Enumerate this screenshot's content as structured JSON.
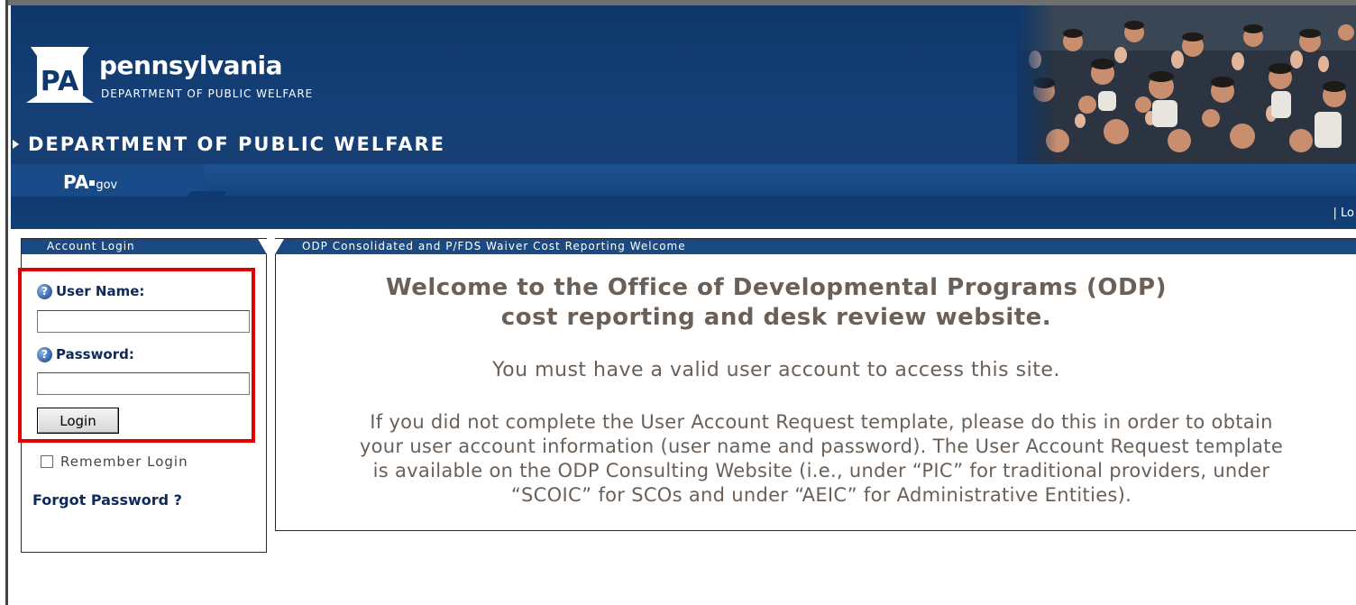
{
  "header": {
    "logo_text": "PA",
    "brand_name": "pennsylvania",
    "brand_subtitle": "DEPARTMENT OF PUBLIC WELFARE",
    "department_title": "DEPARTMENT OF PUBLIC WELFARE",
    "header_color": "#10386c"
  },
  "nav": {
    "portal_prefix": "PA",
    "portal_suffix": "gov",
    "right_link": "| Lo"
  },
  "login": {
    "panel_title": "Account Login",
    "username_label": "User Name:",
    "password_label": "Password:",
    "username_value": "",
    "password_value": "",
    "login_button": "Login",
    "remember_label": "Remember Login",
    "remember_checked": false,
    "forgot_link": "Forgot Password ?",
    "highlight_color": "#e00000"
  },
  "welcome": {
    "panel_title": "ODP Consolidated and P/FDS Waiver Cost Reporting Welcome",
    "title_line1": "Welcome to the Office of Developmental Programs (ODP)",
    "title_line2": "cost reporting and desk review website.",
    "subtitle": "You must have a valid user account to access this site.",
    "body_line1": "If you did not complete the User Account Request template, please do this in order to obtain",
    "body_line2": "your user account information (user name and password). The User Account Request template",
    "body_line3": "is available on the ODP Consulting Website (i.e., under “PIC” for traditional providers, under",
    "body_line4": "“SCOIC” for SCOs and under “AEIC” for Administrative Entities)."
  }
}
